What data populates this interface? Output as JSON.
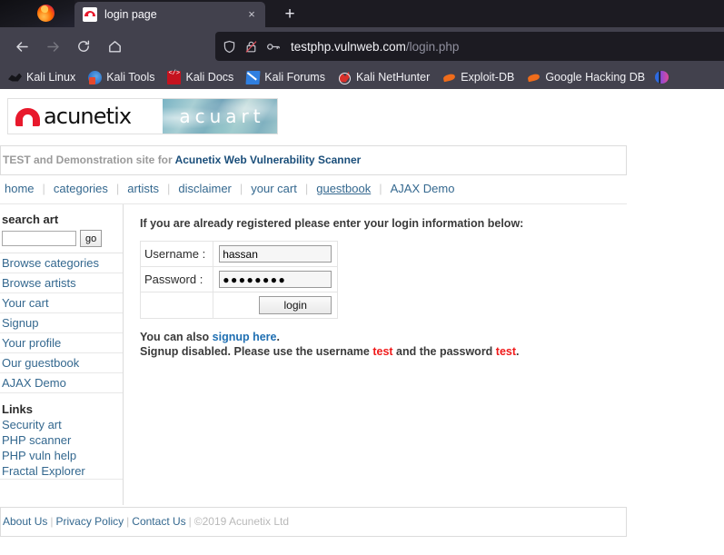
{
  "browser": {
    "tab": {
      "title": "login page",
      "favicon": "acunetix-favicon",
      "close_label": "×"
    },
    "new_tab_label": "+",
    "nav": {
      "back": "back-arrow",
      "forward": "forward-arrow",
      "reload": "reload",
      "home": "home"
    },
    "url": {
      "domain": "testphp.vulnweb.com",
      "path": "/login.php"
    },
    "bookmarks": [
      {
        "label": "Kali Linux",
        "icon": "kali-dragon-icon",
        "cls": "ico-dragon"
      },
      {
        "label": "Kali Tools",
        "icon": "kali-tools-icon",
        "cls": "ico-tools"
      },
      {
        "label": "Kali Docs",
        "icon": "kali-docs-icon",
        "cls": "ico-docs"
      },
      {
        "label": "Kali Forums",
        "icon": "kali-forums-icon",
        "cls": "ico-forums"
      },
      {
        "label": "Kali NetHunter",
        "icon": "kali-nethunter-icon",
        "cls": "ico-nethunter"
      },
      {
        "label": "Exploit-DB",
        "icon": "exploit-db-icon",
        "cls": "ico-exploit"
      },
      {
        "label": "Google Hacking DB",
        "icon": "google-hacking-db-icon",
        "cls": "ico-ghdb"
      }
    ]
  },
  "site": {
    "logo_word": "acunetix",
    "logo_acuart": "acuart",
    "tagline_gray": "TEST and Demonstration site for",
    "tagline_blue": "Acunetix Web Vulnerability Scanner",
    "nav": [
      {
        "label": "home",
        "hovered": false
      },
      {
        "label": "categories",
        "hovered": false
      },
      {
        "label": "artists",
        "hovered": false
      },
      {
        "label": "disclaimer",
        "hovered": false
      },
      {
        "label": "your cart",
        "hovered": false
      },
      {
        "label": "guestbook",
        "hovered": true
      },
      {
        "label": "AJAX Demo",
        "hovered": false
      }
    ],
    "nav_separator": "|"
  },
  "sidebar": {
    "search_title": "search art",
    "search_value": "",
    "search_placeholder": "",
    "go_label": "go",
    "links": [
      {
        "label": "Browse categories"
      },
      {
        "label": "Browse artists"
      },
      {
        "label": "Your cart"
      },
      {
        "label": "Signup"
      },
      {
        "label": "Your profile"
      },
      {
        "label": "Our guestbook"
      },
      {
        "label": "AJAX Demo"
      }
    ],
    "links_title": "Links",
    "extra_links": [
      {
        "label": "Security art"
      },
      {
        "label": "PHP scanner"
      },
      {
        "label": "PHP vuln help"
      },
      {
        "label": "Fractal Explorer"
      }
    ]
  },
  "main": {
    "intro": "If you are already registered please enter your login information below:",
    "username_label": "Username :",
    "username_value": "hassan",
    "password_label": "Password :",
    "password_value": "●●●●●●●●",
    "login_button": "login",
    "note1_prefix": "You can also ",
    "note1_link": "signup here",
    "note1_suffix": ".",
    "note2_prefix": "Signup disabled. Please use the username ",
    "note2_user": "test",
    "note2_middle": " and the password ",
    "note2_pass": "test",
    "note2_suffix": "."
  },
  "footer": {
    "about": "About Us",
    "privacy": "Privacy Policy",
    "contact": "Contact Us",
    "separator": "|",
    "copyright": "©2019 Acunetix Ltd"
  },
  "colors": {
    "link_blue": "#34688f",
    "accent_red": "#e8192c",
    "error_red": "#f01a1a",
    "chrome_dark": "#1c1b22",
    "chrome_toolbar": "#42414d"
  }
}
